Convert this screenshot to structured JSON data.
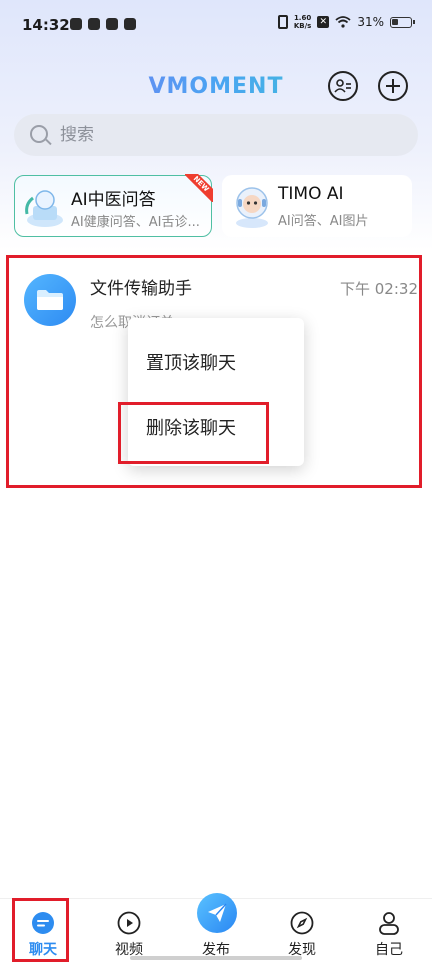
{
  "status_bar": {
    "time": "14:32",
    "net_speed_value": "1.60",
    "net_speed_unit": "KB/s",
    "battery": "31%"
  },
  "header": {
    "brand": "VMOMENT"
  },
  "search": {
    "placeholder": "搜索"
  },
  "promo_cards": [
    {
      "title": "AI中医问答",
      "subtitle": "AI健康问答、AI舌诊...",
      "badge": "NEW"
    },
    {
      "title": "TIMO AI",
      "subtitle": "AI问答、AI图片"
    }
  ],
  "chat_list": [
    {
      "name": "文件传输助手",
      "time": "下午 02:32",
      "preview": "怎么取消订单"
    }
  ],
  "context_menu": {
    "pin": "置顶该聊天",
    "delete": "删除该聊天"
  },
  "bottom_nav": [
    {
      "label": "聊天",
      "active": true
    },
    {
      "label": "视频"
    },
    {
      "label": "发布"
    },
    {
      "label": "发现"
    },
    {
      "label": "自己"
    }
  ],
  "colors": {
    "accent": "#2d8cf0",
    "highlight": "#e11d2a"
  }
}
